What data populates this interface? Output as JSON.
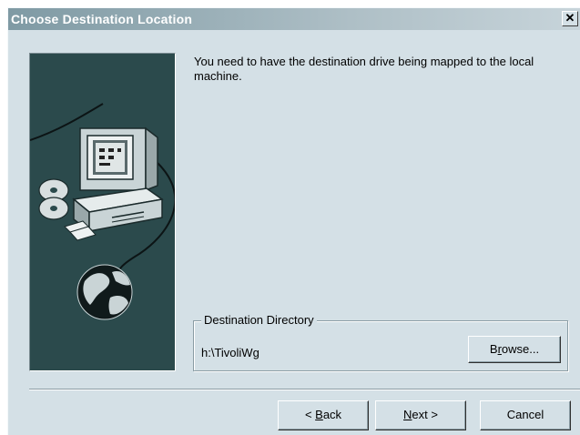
{
  "window": {
    "title": "Choose Destination Location",
    "close_glyph": "✕"
  },
  "illustration": {
    "icon": "computer-disk-globe-illustration"
  },
  "instructions": "You need to have the destination drive being mapped to the local machine.",
  "destination": {
    "group_label": "Destination Directory",
    "path": "h:\\TivoliWg",
    "browse": {
      "pre": "B",
      "mnemonic": "r",
      "post": "owse..."
    }
  },
  "buttons": {
    "back": {
      "pre": "< ",
      "mnemonic": "B",
      "post": "ack"
    },
    "next": {
      "pre": "",
      "mnemonic": "N",
      "post": "ext >"
    },
    "cancel": "Cancel"
  },
  "colors": {
    "dialog_bg": "#d4e0e6",
    "title_bg": "#7f9aa4",
    "art_bg": "#2b4a4c"
  }
}
